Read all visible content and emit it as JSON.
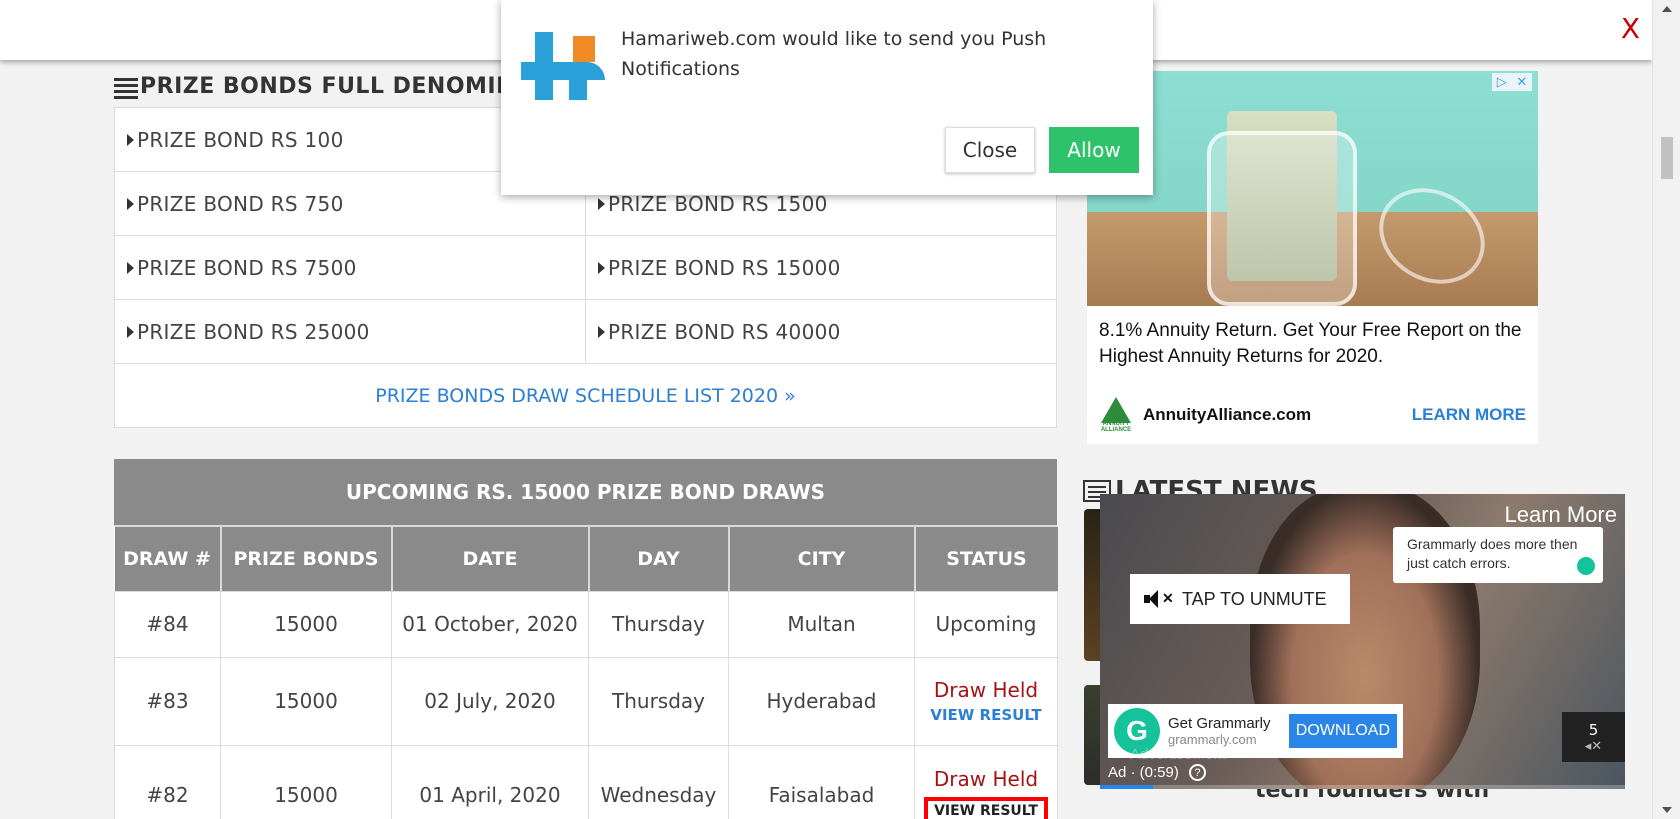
{
  "topbar": {
    "close_label": "X"
  },
  "push": {
    "message": "Hamariweb.com would like to send you Push Notifications",
    "close_label": "Close",
    "allow_label": "Allow"
  },
  "denominations": {
    "title": "PRIZE BONDS FULL DENOMINA",
    "rows": [
      [
        "PRIZE BOND RS 100",
        ""
      ],
      [
        "PRIZE BOND RS 750",
        "PRIZE BOND RS 1500"
      ],
      [
        "PRIZE BOND RS 7500",
        "PRIZE BOND RS 15000"
      ],
      [
        "PRIZE BOND RS 25000",
        "PRIZE BOND RS 40000"
      ]
    ],
    "schedule_link": "PRIZE BONDS DRAW SCHEDULE LIST 2020 »"
  },
  "draws": {
    "title": "UPCOMING RS. 15000 PRIZE BOND DRAWS",
    "columns": [
      "DRAW #",
      "PRIZE BONDS",
      "DATE",
      "DAY",
      "CITY",
      "STATUS"
    ],
    "rows": [
      {
        "draw": "#84",
        "bond": "15000",
        "date": "01 October, 2020",
        "day": "Thursday",
        "city": "Multan",
        "status": "Upcoming",
        "link": ""
      },
      {
        "draw": "#83",
        "bond": "15000",
        "date": "02 July, 2020",
        "day": "Thursday",
        "city": "Hyderabad",
        "status": "Draw Held",
        "link": "VIEW RESULT"
      },
      {
        "draw": "#82",
        "bond": "15000",
        "date": "01 April, 2020",
        "day": "Wednesday",
        "city": "Faisalabad",
        "status": "Draw Held",
        "link": "VIEW RESULT"
      }
    ]
  },
  "ad_annuity": {
    "copy": "8.1% Annuity Return. Get Your Free Report on the Highest Annuity Returns for 2020.",
    "brand": "AnnuityAlliance.com",
    "logo_text": "ANNUITY ALLIANCE",
    "cta": "LEARN MORE"
  },
  "news": {
    "title": "LATEST NEWS",
    "caption": "tech founders with"
  },
  "video_ad": {
    "learn_more": "Learn More",
    "bubble": "Grammarly does more then just catch errors.",
    "unmute": "TAP TO UNMUTE",
    "brand_title": "Get Grammarly",
    "brand_url": "grammarly.com",
    "download": "DOWNLOAD",
    "ad_time": "Ad · (0:59)",
    "advert_label": "Advertisement",
    "skip_count": "5",
    "progress": 0.1
  },
  "colors": {
    "accent_blue": "#2b7fd4",
    "upcoming_green": "#1e9a1e",
    "held_red": "#a31515",
    "allow_green": "#2ec36b"
  }
}
